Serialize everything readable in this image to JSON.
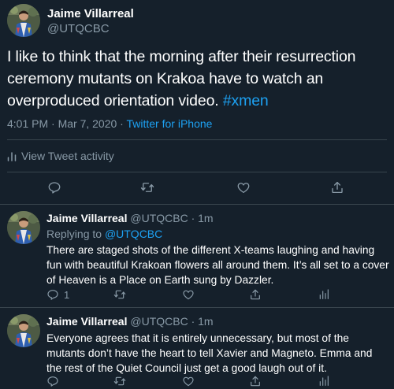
{
  "main_tweet": {
    "author_name": "Jaime Villarreal",
    "handle": "@UTQCBC",
    "text_plain": "I like to think that the morning after their resurrection ceremony mutants on Krakoa have to watch an overproduced orientation video. ",
    "hashtag": "#xmen",
    "timestamp": "4:01 PM · Mar 7, 2020 · ",
    "source": "Twitter for iPhone",
    "activity_label": "View Tweet activity",
    "actions": [
      "reply-icon",
      "retweet-icon",
      "like-icon",
      "share-icon"
    ]
  },
  "replies": [
    {
      "author_name": "Jaime Villarreal",
      "handle_time": " @UTQCBC · 1m",
      "replying_prefix": "Replying to ",
      "replying_to": "@UTQCBC",
      "text": "There are staged shots of the different X-teams laughing and having fun with beautiful Krakoan flowers all around them. It’s all set to a cover of Heaven is a Place on Earth sung by Dazzler.",
      "reply_count": "1",
      "actions": [
        "reply-icon",
        "retweet-icon",
        "like-icon",
        "share-icon",
        "analytics-icon"
      ]
    },
    {
      "author_name": "Jaime Villarreal",
      "handle_time": " @UTQCBC · 1m",
      "text": "Everyone agrees that it is entirely unnecessary, but most of the mutants don’t have the heart to tell Xavier and Magneto. Emma and the rest of the Quiet Council just get a good laugh out of it.",
      "actions": [
        "reply-icon",
        "retweet-icon",
        "like-icon",
        "share-icon",
        "analytics-icon"
      ]
    }
  ],
  "colors": {
    "background": "#15202b",
    "text": "#ffffff",
    "muted": "#8899a6",
    "accent": "#1da1f2",
    "divider": "#38444d"
  }
}
